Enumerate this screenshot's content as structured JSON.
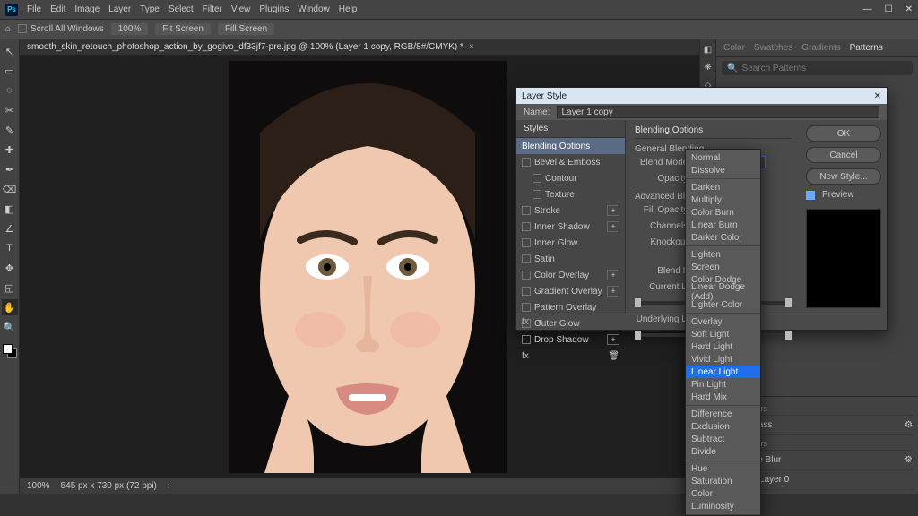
{
  "menubar": {
    "items": [
      "File",
      "Edit",
      "Image",
      "Layer",
      "Type",
      "Select",
      "Filter",
      "View",
      "Plugins",
      "Window",
      "Help"
    ]
  },
  "optbar": {
    "scroll_all": "Scroll All Windows",
    "zoom": "100%",
    "fit": "Fit Screen",
    "fill": "Fill Screen"
  },
  "doc": {
    "tab": "smooth_skin_retouch_photoshop_action_by_gogivo_df33jf7-pre.jpg @ 100% (Layer 1 copy, RGB/8#/CMYK) *"
  },
  "statusbar": {
    "zoom": "100%",
    "info": "545 px x 730 px (72 ppi)"
  },
  "right_panels": {
    "tabs": [
      "Color",
      "Swatches",
      "Gradients",
      "Patterns"
    ],
    "active_tab": 3,
    "search_placeholder": "Search Patterns"
  },
  "layers": {
    "smart_filters_label": "Smart Filters",
    "items": [
      {
        "label": "igh Pass"
      },
      {
        "label": "urface Blur"
      },
      {
        "label": "Layer 0"
      }
    ]
  },
  "dialog": {
    "title": "Layer Style",
    "name_label": "Name:",
    "name_value": "Layer 1 copy",
    "styles_header": "Styles",
    "left_items": [
      {
        "label": "Blending Options",
        "plus": false,
        "active": true,
        "check": false
      },
      {
        "label": "Bevel & Emboss",
        "plus": false,
        "check": true
      },
      {
        "label": "Contour",
        "plus": false,
        "check": true,
        "indent": true
      },
      {
        "label": "Texture",
        "plus": false,
        "check": true,
        "indent": true
      },
      {
        "label": "Stroke",
        "plus": true,
        "check": true
      },
      {
        "label": "Inner Shadow",
        "plus": true,
        "check": true
      },
      {
        "label": "Inner Glow",
        "plus": false,
        "check": true
      },
      {
        "label": "Satin",
        "plus": false,
        "check": true
      },
      {
        "label": "Color Overlay",
        "plus": true,
        "check": true
      },
      {
        "label": "Gradient Overlay",
        "plus": true,
        "check": true
      },
      {
        "label": "Pattern Overlay",
        "plus": false,
        "check": true
      },
      {
        "label": "Outer Glow",
        "plus": false,
        "check": true
      },
      {
        "label": "Drop Shadow",
        "plus": true,
        "check": true
      }
    ],
    "mid": {
      "header": "Blending Options",
      "general_header": "General Blending",
      "blend_mode_label": "Blend Mode:",
      "blend_mode_value": "Linear Light",
      "opacity_label": "Opacity:",
      "adv_header": "Advanced Blendi",
      "fill_opacity": "Fill Opacity:",
      "channels": "Channels:",
      "knockout": "Knockout:",
      "blend_if": "Blend If:",
      "current_layer": "Current Layer:",
      "underlying_layer": "Underlying Layer:"
    },
    "buttons": {
      "ok": "OK",
      "cancel": "Cancel",
      "newstyle": "New Style..."
    },
    "preview_label": "Preview"
  },
  "dropdown": {
    "selected": "Linear Light",
    "groups": [
      [
        "Normal",
        "Dissolve"
      ],
      [
        "Darken",
        "Multiply",
        "Color Burn",
        "Linear Burn",
        "Darker Color"
      ],
      [
        "Lighten",
        "Screen",
        "Color Dodge",
        "Linear Dodge (Add)",
        "Lighter Color"
      ],
      [
        "Overlay",
        "Soft Light",
        "Hard Light",
        "Vivid Light",
        "Linear Light",
        "Pin Light",
        "Hard Mix"
      ],
      [
        "Difference",
        "Exclusion",
        "Subtract",
        "Divide"
      ],
      [
        "Hue",
        "Saturation",
        "Color",
        "Luminosity"
      ]
    ]
  },
  "tools": [
    "↖",
    "▭",
    "◌",
    "✂",
    "✎",
    "✚",
    "✒",
    "⌫",
    "◧",
    "∠",
    "T",
    "✥",
    "◱",
    "✋",
    "🔍"
  ]
}
